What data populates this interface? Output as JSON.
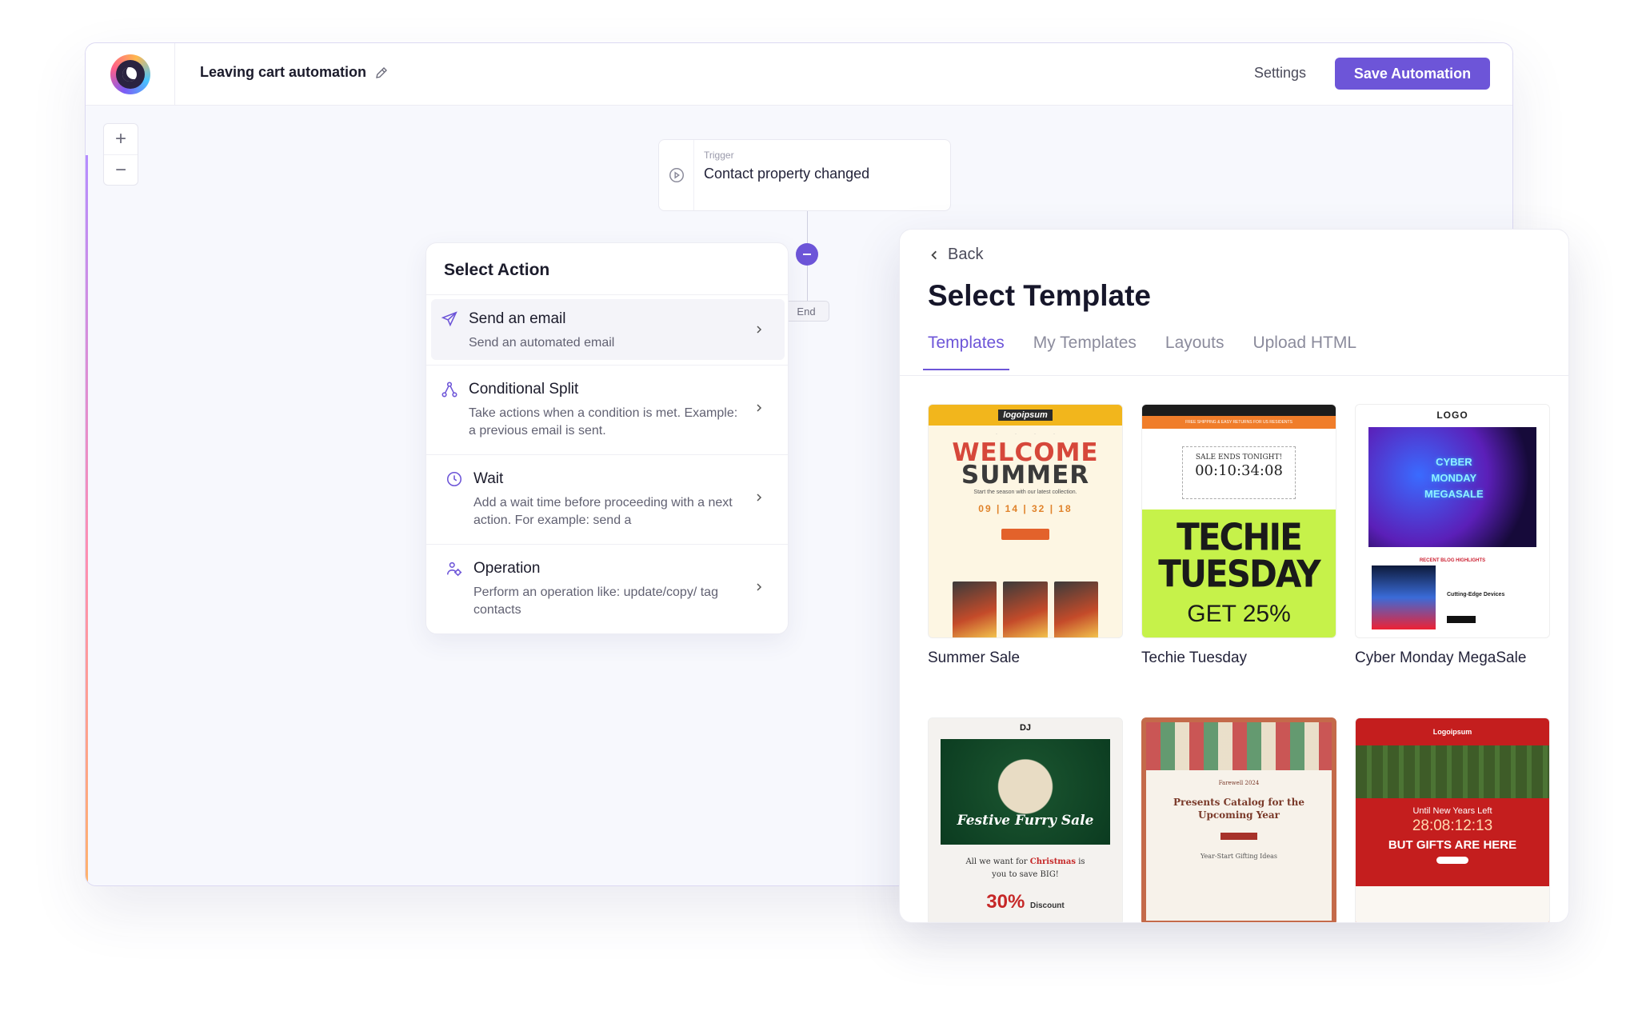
{
  "header": {
    "automation_title": "Leaving cart automation",
    "settings_label": "Settings",
    "save_label": "Save Automation"
  },
  "canvas": {
    "zoom_in": "+",
    "zoom_out": "−",
    "trigger_label": "Trigger",
    "trigger_value": "Contact property changed",
    "end_label": "End"
  },
  "action_panel": {
    "title": "Select Action",
    "items": [
      {
        "title": "Send an email",
        "desc": "Send an automated email",
        "icon": "send-icon"
      },
      {
        "title": "Conditional Split",
        "desc": "Take actions when a condition is met. Example: a previous email is sent.",
        "icon": "split-icon"
      },
      {
        "title": "Wait",
        "desc": "Add a wait time before proceeding with a next action. For example: send a",
        "icon": "clock-icon"
      },
      {
        "title": "Operation",
        "desc": "Perform an operation like: update/copy/ tag contacts",
        "icon": "operation-icon"
      }
    ]
  },
  "template_panel": {
    "back_label": "Back",
    "title": "Select Template",
    "tabs": [
      {
        "label": "Templates"
      },
      {
        "label": "My Templates"
      },
      {
        "label": "Layouts"
      },
      {
        "label": "Upload HTML"
      }
    ],
    "active_tab": "Templates",
    "templates": [
      {
        "name": "Summer Sale"
      },
      {
        "name": "Techie Tuesday"
      },
      {
        "name": "Cyber Monday MegaSale"
      }
    ],
    "thumbs": {
      "summer": {
        "logo": "logoipsum",
        "line1": "WELCOME",
        "line2": "SUMMER",
        "sub": "Start the season with our latest collection.",
        "count": "09 | 14 | 32 | 18"
      },
      "techie": {
        "stripe": "FREE SHIPPING & EASY RETURNS FOR US RESIDENTS",
        "sale": "SALE ENDS TONIGHT!",
        "timer": "00:10:34:08",
        "line1": "TECHIE",
        "line2": "TUESDAY",
        "offer": "GET 25%"
      },
      "cyber": {
        "logo": "LOGO",
        "l1": "CYBER",
        "l2": "MONDAY",
        "l3": "MEGASALE",
        "blog": "RECENT BLOG HIGHLIGHTS",
        "blog_title": "Cutting-Edge Devices"
      },
      "festive": {
        "logo": "DJ",
        "title": "Festive Furry Sale",
        "line_a": "All we want for",
        "line_b": "Christmas",
        "line_c": "is",
        "line_d": "you to save BIG!",
        "pct": "30%",
        "disc": "Discount"
      },
      "presents": {
        "small": "Farewell 2024",
        "head1": "Presents Catalog for the",
        "head2": "Upcoming Year",
        "gift": "Year-Start Gifting Ideas"
      },
      "xmas": {
        "logo": "Logoipsum",
        "txt1": "Until New Years Left",
        "timer": "28:08:12:13",
        "txt2": "BUT GIFTS ARE HERE"
      }
    }
  },
  "colors": {
    "accent": "#6d55d8"
  }
}
